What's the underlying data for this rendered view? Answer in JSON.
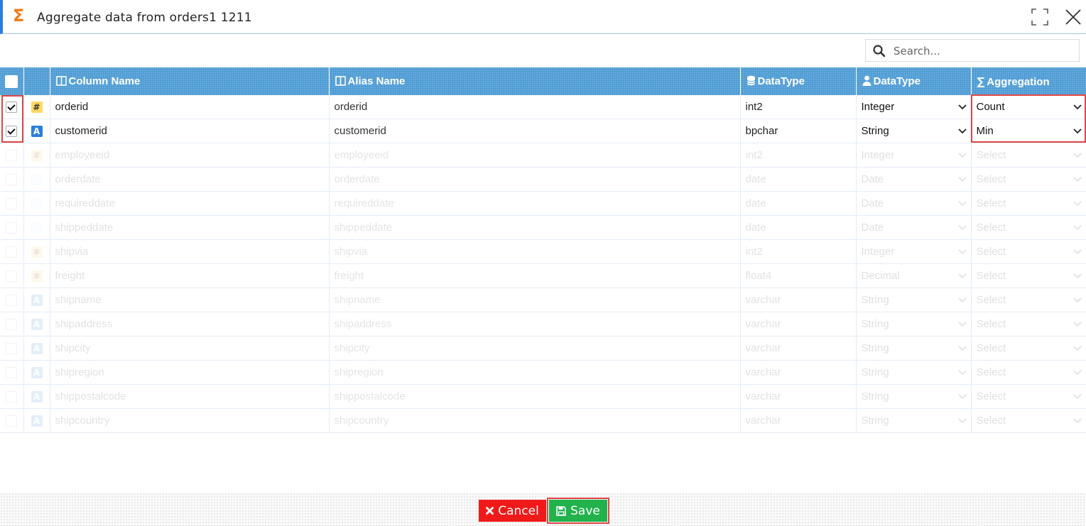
{
  "dialog": {
    "title": "Aggregate data from orders1 1211",
    "title_icon": "sigma-icon",
    "accent_color": "#f07c1a"
  },
  "search": {
    "placeholder": "Search..."
  },
  "table": {
    "header_color": "#4a9ad4",
    "columns": {
      "column_name": "Column Name",
      "alias_name": "Alias Name",
      "source_type": "DataType",
      "target_type": "DataType",
      "aggregation": "Aggregation"
    },
    "rows": [
      {
        "checked": true,
        "icon": "number-type-icon",
        "name": "orderid",
        "alias": "orderid",
        "dtype": "int2",
        "type": "Integer",
        "agg": "Count"
      },
      {
        "checked": true,
        "icon": "string-type-icon",
        "name": "customerid",
        "alias": "customerid",
        "dtype": "bpchar",
        "type": "String",
        "agg": "Min"
      },
      {
        "checked": false,
        "icon": "number-type-icon",
        "name": "employeeid",
        "alias": "employeeid",
        "dtype": "int2",
        "type": "Integer",
        "agg": "Select"
      },
      {
        "checked": false,
        "icon": "date-type-icon",
        "name": "orderdate",
        "alias": "orderdate",
        "dtype": "date",
        "type": "Date",
        "agg": "Select"
      },
      {
        "checked": false,
        "icon": "date-type-icon",
        "name": "requireddate",
        "alias": "requireddate",
        "dtype": "date",
        "type": "Date",
        "agg": "Select"
      },
      {
        "checked": false,
        "icon": "date-type-icon",
        "name": "shippeddate",
        "alias": "shippeddate",
        "dtype": "date",
        "type": "Date",
        "agg": "Select"
      },
      {
        "checked": false,
        "icon": "number-type-icon",
        "name": "shipvia",
        "alias": "shipvia",
        "dtype": "int2",
        "type": "Integer",
        "agg": "Select"
      },
      {
        "checked": false,
        "icon": "number-type-icon",
        "name": "freight",
        "alias": "freight",
        "dtype": "float4",
        "type": "Decimal",
        "agg": "Select"
      },
      {
        "checked": false,
        "icon": "string-type-icon",
        "name": "shipname",
        "alias": "shipname",
        "dtype": "varchar",
        "type": "String",
        "agg": "Select"
      },
      {
        "checked": false,
        "icon": "string-type-icon",
        "name": "shipaddress",
        "alias": "shipaddress",
        "dtype": "varchar",
        "type": "String",
        "agg": "Select"
      },
      {
        "checked": false,
        "icon": "string-type-icon",
        "name": "shipcity",
        "alias": "shipcity",
        "dtype": "varchar",
        "type": "String",
        "agg": "Select"
      },
      {
        "checked": false,
        "icon": "string-type-icon",
        "name": "shipregion",
        "alias": "shipregion",
        "dtype": "varchar",
        "type": "String",
        "agg": "Select"
      },
      {
        "checked": false,
        "icon": "string-type-icon",
        "name": "shippostalcode",
        "alias": "shippostalcode",
        "dtype": "varchar",
        "type": "String",
        "agg": "Select"
      },
      {
        "checked": false,
        "icon": "string-type-icon",
        "name": "shipcountry",
        "alias": "shipcountry",
        "dtype": "varchar",
        "type": "String",
        "agg": "Select"
      }
    ]
  },
  "footer": {
    "cancel_label": "Cancel",
    "save_label": "Save",
    "cancel_color": "#f01a1a",
    "save_color": "#22b24c"
  }
}
